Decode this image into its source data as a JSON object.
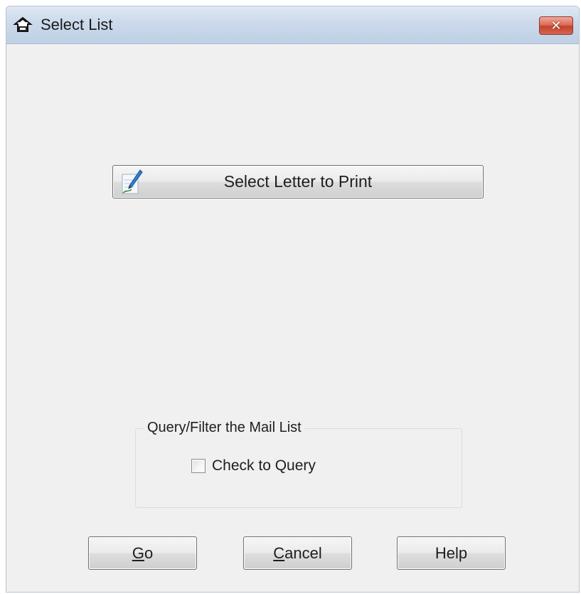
{
  "window": {
    "title": "Select List",
    "title_icon": "printer-icon",
    "close_label": "✕"
  },
  "main": {
    "select_button": {
      "label": "Select Letter to Print",
      "icon": "letter-pen-icon"
    },
    "query_group": {
      "legend": "Query/Filter the Mail List",
      "checkbox_label": "Check to Query",
      "checked": false
    }
  },
  "footer": {
    "go": {
      "mnemonic": "G",
      "rest": "o"
    },
    "cancel": {
      "mnemonic": "C",
      "rest": "ancel"
    },
    "help": {
      "label": "Help"
    }
  }
}
